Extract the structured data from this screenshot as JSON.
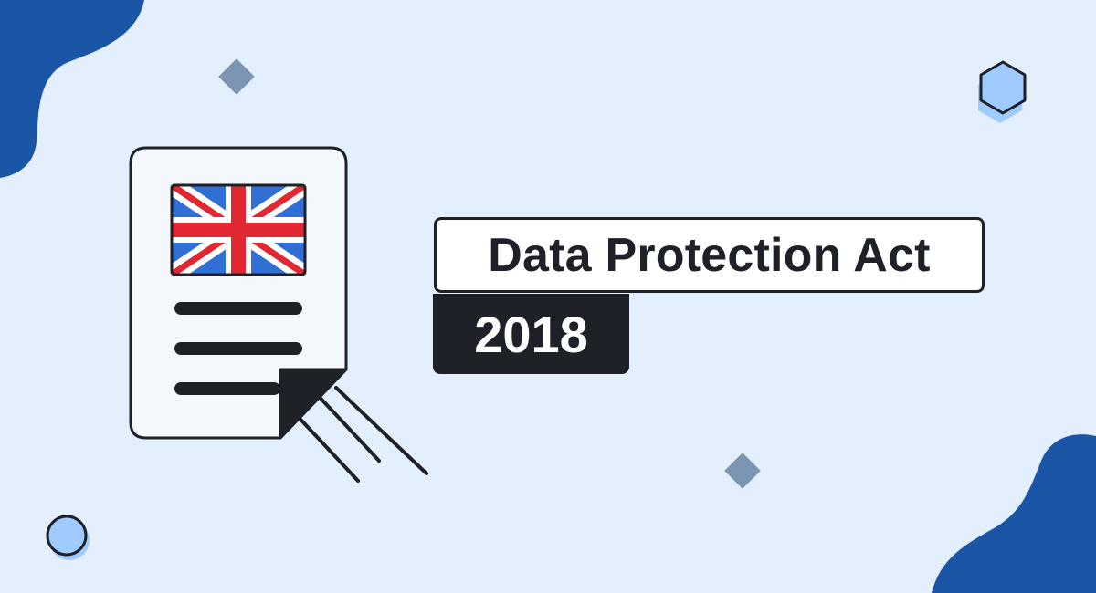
{
  "banner": {
    "title": "Data Protection Act",
    "year": "2018"
  },
  "document_icon": {
    "flag": "united-kingdom-flag"
  },
  "colors": {
    "background": "#e4effd",
    "blob": "#1b56a6",
    "ink": "#1e2128",
    "page": "#f4f7fb",
    "flag_blue": "#2f6fd6",
    "flag_red": "#e02732",
    "accent_light_blue": "#9fcbff",
    "diamond": "#7b95b3"
  }
}
